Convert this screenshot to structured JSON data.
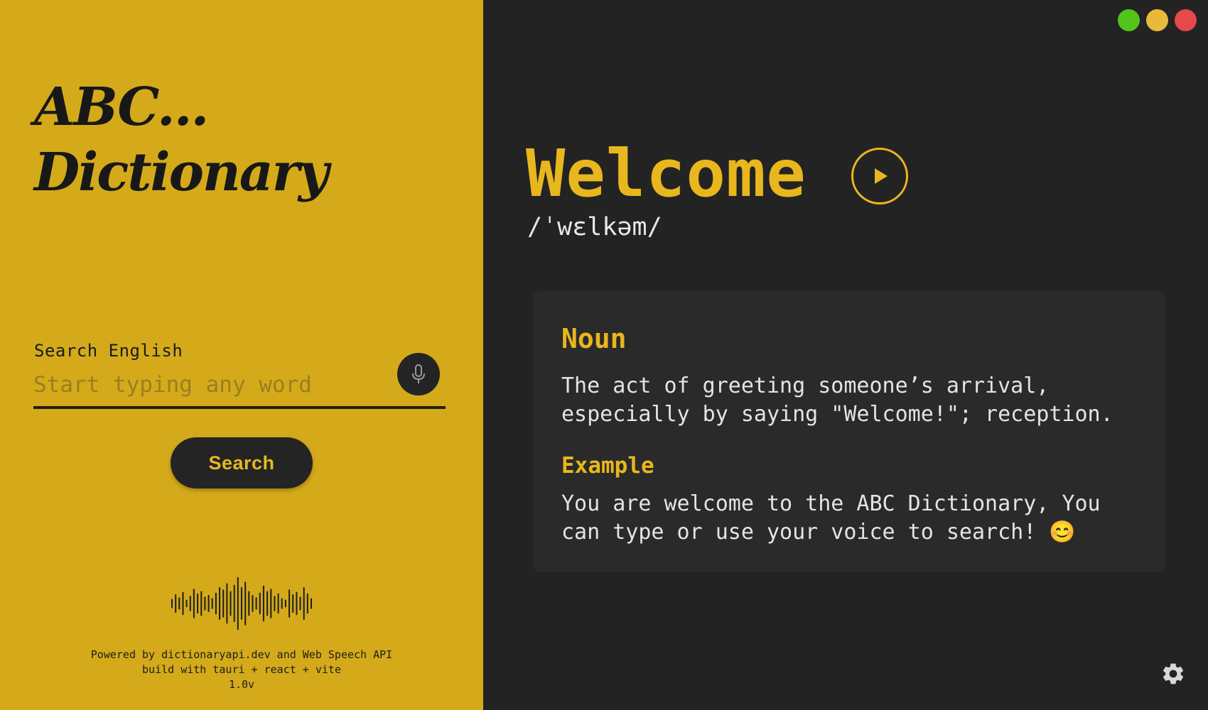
{
  "app": {
    "logo_line1": "ABC...",
    "logo_line2": "Dictionary"
  },
  "search": {
    "label": "Search English",
    "placeholder": "Start typing any word",
    "value": "",
    "mic_icon": "microphone-icon",
    "button_label": "Search"
  },
  "waveform_icon": "sound-wave-icon",
  "footer": {
    "line1": "Powered by dictionaryapi.dev and Web Speech API",
    "line2": "build with tauri + react + vite",
    "version": "1.0v"
  },
  "window_controls": {
    "colors": [
      "#52c41a",
      "#e9b93a",
      "#e5484d"
    ]
  },
  "entry": {
    "word": "Welcome",
    "phonetic": "/ˈwɛlkəm/",
    "play_icon": "play-icon",
    "part_of_speech": "Noun",
    "definition": "The act of greeting someone’s arrival, especially by saying \"Welcome!\"; reception.",
    "example_heading": "Example",
    "example": "You are welcome to the ABC Dictionary, You can type or use your voice to search! 😊"
  },
  "settings_icon": "gear-icon",
  "colors": {
    "accent": "#e8b71d",
    "left_panel": "#d4aa1a",
    "dark": "#232323",
    "card": "#2a2a2a"
  }
}
